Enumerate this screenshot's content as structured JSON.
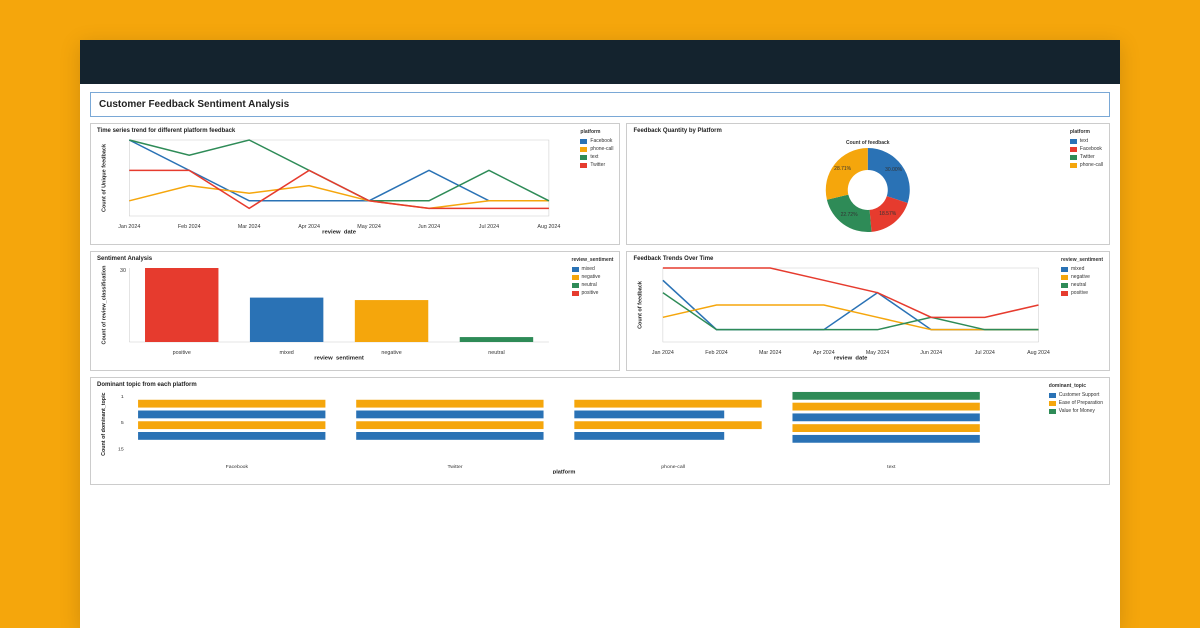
{
  "page_title": "Customer Feedback Sentiment Analysis",
  "colors": {
    "blue": "#2a72b5",
    "orange": "#f5a60c",
    "green": "#2e8b57",
    "red": "#e63b2e"
  },
  "chart_data": [
    {
      "id": "time_series",
      "type": "line",
      "title": "Time series trend for different platform feedback",
      "xlabel": "review_date",
      "ylabel": "Count of Unique feedback",
      "categories": [
        "Jan 2024",
        "Feb 2024",
        "Mar 2024",
        "Apr 2024",
        "May 2024",
        "Jun 2024",
        "Jul 2024",
        "Aug 2024"
      ],
      "legend_title": "platform",
      "series": [
        {
          "name": "Facebook",
          "color": "#2a72b5",
          "values": [
            5,
            3,
            1,
            1,
            1,
            3,
            1,
            1
          ]
        },
        {
          "name": "phone-call",
          "color": "#f5a60c",
          "values": [
            1,
            2,
            1.5,
            2,
            1,
            0.5,
            1,
            1
          ]
        },
        {
          "name": "text",
          "color": "#2e8b57",
          "values": [
            5,
            4,
            5,
            3,
            1,
            1,
            3,
            1
          ]
        },
        {
          "name": "Twitter",
          "color": "#e63b2e",
          "values": [
            3,
            3,
            0.5,
            3,
            1,
            0.5,
            0.5,
            0.5
          ]
        }
      ],
      "ylim": [
        0,
        5
      ]
    },
    {
      "id": "pie",
      "type": "pie",
      "title": "Feedback Quantity by Platform",
      "center_label": "Count of feedback",
      "legend_title": "platform",
      "series": [
        {
          "name": "text",
          "color": "#2a72b5",
          "value": 30.0,
          "label": "30.00%"
        },
        {
          "name": "Facebook",
          "color": "#e63b2e",
          "value": 18.57,
          "label": "18.57%"
        },
        {
          "name": "Twitter",
          "color": "#2e8b57",
          "value": 22.72,
          "label": "22.72%"
        },
        {
          "name": "phone-call",
          "color": "#f5a60c",
          "value": 28.71,
          "label": "28.71%"
        }
      ]
    },
    {
      "id": "sentiment_bar",
      "type": "bar",
      "title": "Sentiment Analysis",
      "xlabel": "review_sentiment",
      "ylabel": "Count of review_classification",
      "legend_title": "review_sentiment",
      "categories": [
        "positive",
        "mixed",
        "negative",
        "neutral"
      ],
      "series": [
        {
          "name": "positive",
          "color": "#e63b2e",
          "value": 30
        },
        {
          "name": "mixed",
          "color": "#2a72b5",
          "value": 18
        },
        {
          "name": "negative",
          "color": "#f5a60c",
          "value": 17
        },
        {
          "name": "neutral",
          "color": "#2e8b57",
          "value": 2
        }
      ],
      "ylim": [
        0,
        30
      ]
    },
    {
      "id": "trend_sentiment",
      "type": "line",
      "title": "Feedback Trends Over Time",
      "xlabel": "review_date",
      "ylabel": "Count of feedback",
      "categories": [
        "Jan 2024",
        "Feb 2024",
        "Mar 2024",
        "Apr 2024",
        "May 2024",
        "Jun 2024",
        "Jul 2024",
        "Aug 2024"
      ],
      "legend_title": "review_sentiment",
      "series": [
        {
          "name": "mixed",
          "color": "#2a72b5",
          "values": [
            5,
            1,
            1,
            1,
            4,
            1,
            1,
            1
          ]
        },
        {
          "name": "negative",
          "color": "#f5a60c",
          "values": [
            2,
            3,
            3,
            3,
            2,
            1,
            1,
            1
          ]
        },
        {
          "name": "neutral",
          "color": "#2e8b57",
          "values": [
            4,
            1,
            1,
            1,
            1,
            2,
            1,
            1
          ]
        },
        {
          "name": "positive",
          "color": "#e63b2e",
          "values": [
            6,
            6,
            6,
            5,
            4,
            2,
            2,
            3
          ]
        }
      ],
      "ylim": [
        0,
        6
      ]
    },
    {
      "id": "dominant_topic",
      "type": "bar",
      "title": "Dominant topic from each platform",
      "xlabel": "platform",
      "ylabel": "Count of dominant_topic",
      "legend_title": "dominant_topic",
      "categories": [
        "Facebook",
        "Twitter",
        "phone-call",
        "text"
      ],
      "yticks": [
        "1",
        "5",
        "15"
      ],
      "series": [
        {
          "name": "Customer Support",
          "color": "#2a72b5",
          "stacks": [
            [
              1,
              1
            ],
            [
              1,
              1
            ],
            [
              1,
              0.8
            ],
            [
              1,
              1
            ]
          ]
        },
        {
          "name": "Ease of Preparation",
          "color": "#f5a60c",
          "stacks": [
            [
              1,
              1
            ],
            [
              1,
              1
            ],
            [
              1,
              1
            ],
            [
              1,
              1
            ]
          ]
        },
        {
          "name": "Value for Money",
          "color": "#2e8b57",
          "stacks": [
            [
              0,
              0
            ],
            [
              0,
              0
            ],
            [
              0,
              0
            ],
            [
              1,
              1
            ]
          ]
        }
      ]
    }
  ]
}
